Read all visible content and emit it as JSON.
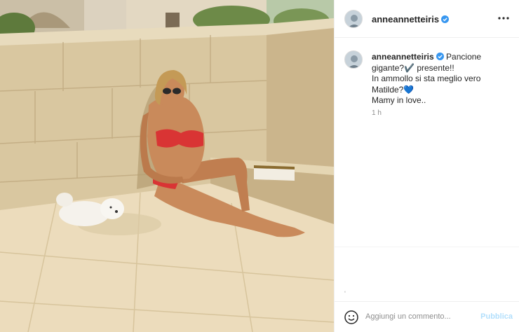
{
  "post": {
    "username": "anneannetteiris",
    "verified_icon": "verified-badge-icon",
    "more_icon": "more-options-icon",
    "accent_color": "#3897f0"
  },
  "caption": {
    "username": "anneannetteiris",
    "lines": [
      "Pancione",
      "gigante?✔️ presente!!",
      "In ammollo si sta meglio vero",
      "Matilde?💙",
      "Mamy in love.."
    ],
    "timestamp": "1 h"
  },
  "comment": {
    "emoji_icon": "emoji-smiley-icon",
    "placeholder": "Aggiungi un commento...",
    "publish_label": "Pubblica",
    "publish_color": "#b2dffc"
  },
  "footer_mark": "‘"
}
